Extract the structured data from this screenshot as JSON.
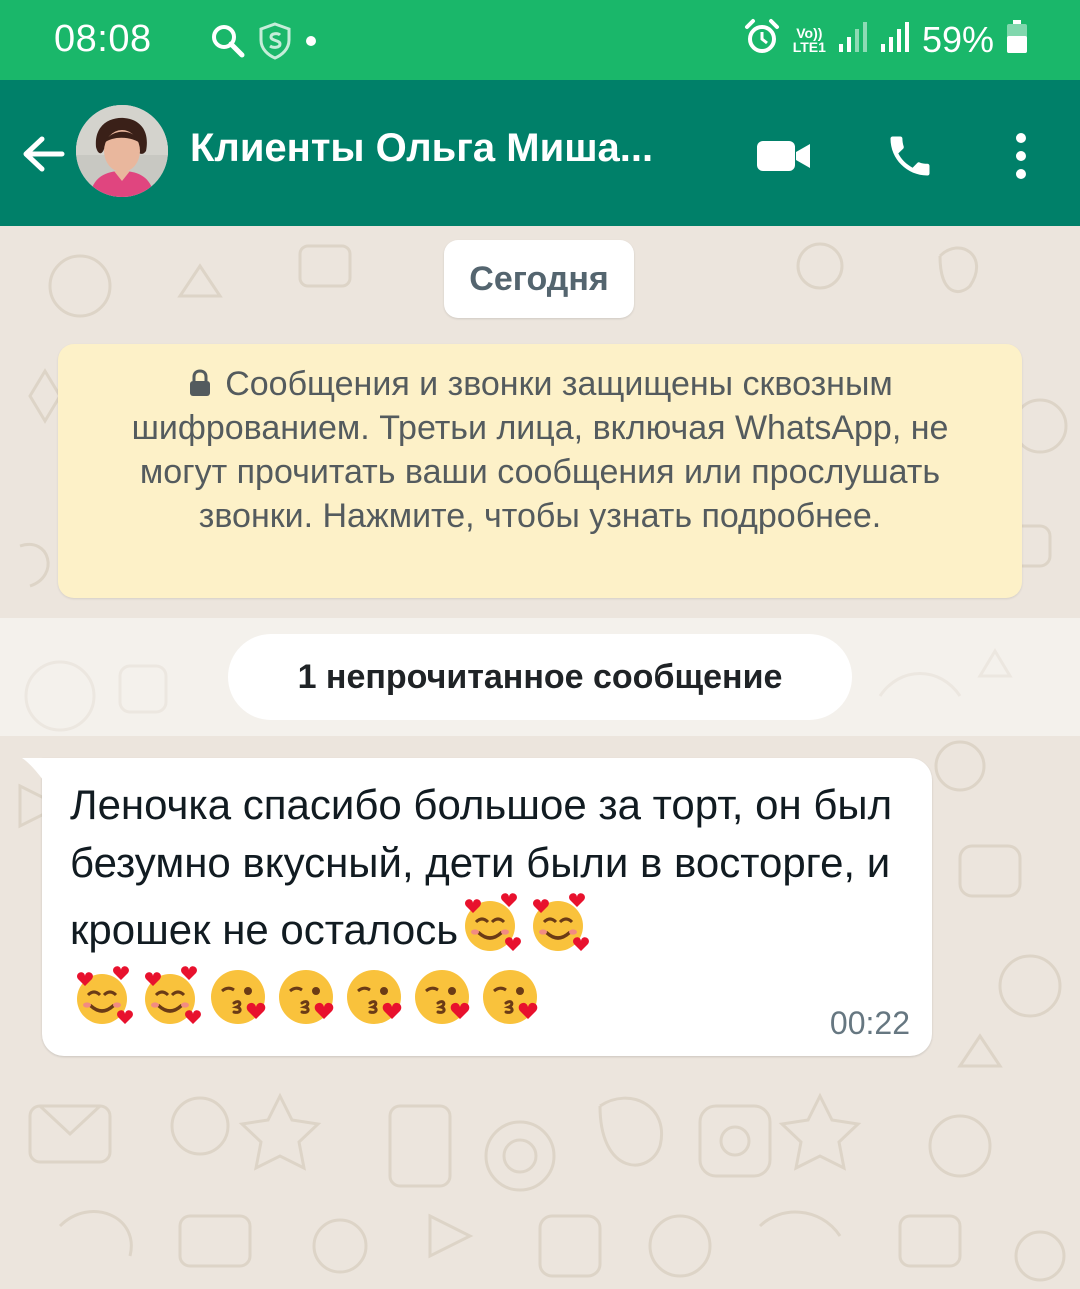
{
  "colors": {
    "status_bar": "#1ab76a",
    "header": "#008069",
    "chat_background": "#ece5dd",
    "notice_background": "#fdf1c8",
    "bubble": "#ffffff"
  },
  "status_bar": {
    "time": "08:08",
    "left_icons": [
      "search-icon",
      "shield-s-icon",
      "dot-icon"
    ],
    "volte_top": "Vo))",
    "volte_bottom": "LTE1",
    "right_icons": [
      "alarm-icon",
      "volte-lte-icon",
      "signal-icon",
      "signal-icon",
      "battery-icon"
    ],
    "battery": "59%"
  },
  "header": {
    "back_icon": "arrow-left-icon",
    "title": "Клиенты Ольга Миша...",
    "video_icon": "video-camera-icon",
    "call_icon": "phone-icon",
    "menu_icon": "more-vertical-icon"
  },
  "chat": {
    "date_label": "Сегодня",
    "encryption_notice": "Сообщения и звонки защищены сквозным шифрованием. Третьи лица, включая WhatsApp, не могут прочитать ваши сообщения или прослушать звонки. Нажмите, чтобы узнать подробнее.",
    "unread_label": "1 непрочитанное сообщение",
    "message": {
      "text": "Леночка спасибо большое за торт, он был безумно вкусный, дети были в восторге, и крошек не осталось",
      "emojis_inline": [
        "smiling-face-with-hearts",
        "smiling-face-with-hearts"
      ],
      "emojis_line": [
        "smiling-face-with-hearts",
        "smiling-face-with-hearts",
        "face-blowing-kiss",
        "face-blowing-kiss",
        "face-blowing-kiss",
        "face-blowing-kiss",
        "face-blowing-kiss"
      ],
      "time": "00:22"
    }
  }
}
